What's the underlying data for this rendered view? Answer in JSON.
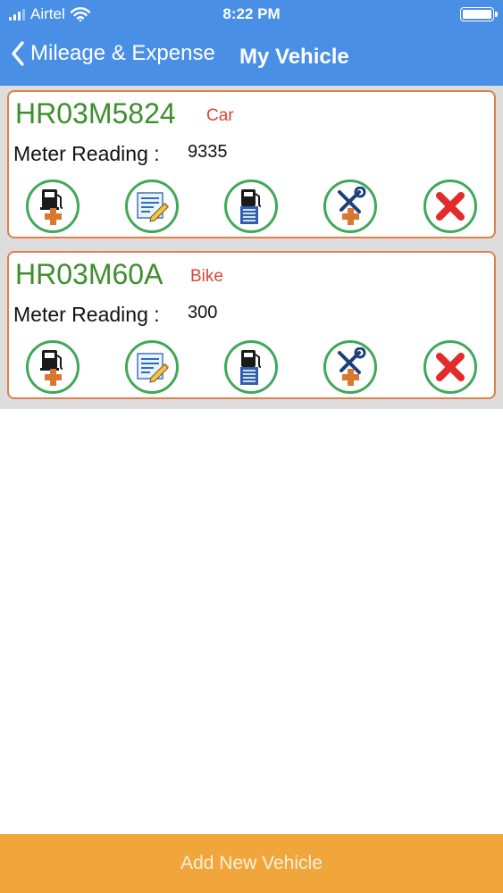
{
  "status_bar": {
    "carrier": "Airtel",
    "time": "8:22 PM"
  },
  "nav": {
    "back_label": "Mileage & Expense",
    "title": "My Vehicle"
  },
  "vehicles": [
    {
      "plate": "HR03M5824",
      "type": "Car",
      "meter_label": "Meter Reading :",
      "meter_value": "9335"
    },
    {
      "plate": "HR03M60A",
      "type": "Bike",
      "meter_label": "Meter Reading :",
      "meter_value": "300"
    }
  ],
  "action_icons": [
    "add-fuel-icon",
    "edit-note-icon",
    "fuel-log-icon",
    "add-service-icon",
    "delete-x-icon"
  ],
  "colors": {
    "header": "#4a8fe6",
    "plate": "#3d8f2e",
    "vehicle_type": "#d6453a",
    "card_border": "#e07f4a",
    "action_ring": "#3fa85a",
    "footer": "#f0a63a"
  },
  "footer": {
    "add_label": "Add New Vehicle"
  }
}
